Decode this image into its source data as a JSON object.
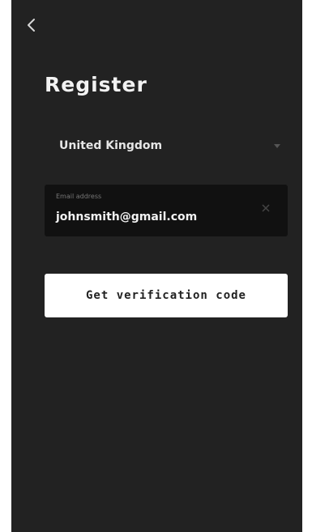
{
  "header": {
    "back_icon": "chevron-left-icon",
    "title": "Register"
  },
  "form": {
    "country": {
      "value": "United Kingdom",
      "icon": "caret-down-icon"
    },
    "email": {
      "caption": "Email address",
      "value": "johnsmith@gmail.com",
      "clear_icon": "close-icon"
    },
    "submit_label": "Get verification code"
  },
  "colors": {
    "background": "#222222",
    "field_background": "#111111",
    "button_background": "#ffffff",
    "text_primary": "#f2f2f2"
  }
}
